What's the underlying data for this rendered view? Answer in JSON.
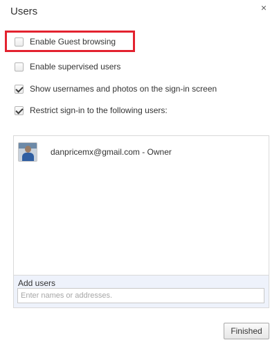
{
  "dialog": {
    "title": "Users",
    "close_glyph": "×"
  },
  "options": [
    {
      "label": "Enable Guest browsing",
      "checked": false
    },
    {
      "label": "Enable supervised users",
      "checked": false
    },
    {
      "label": "Show usernames and photos on the sign-in screen",
      "checked": true
    },
    {
      "label": "Restrict sign-in to the following users:",
      "checked": true
    }
  ],
  "users": [
    {
      "name": "danpricemx@gmail.com - Owner",
      "avatar_icon": "user-photo"
    }
  ],
  "add_users": {
    "label": "Add users",
    "placeholder": "Enter names or addresses."
  },
  "footer": {
    "finished_label": "Finished"
  },
  "colors": {
    "highlight": "#e3222f",
    "add_panel_bg": "#eef2fb"
  }
}
